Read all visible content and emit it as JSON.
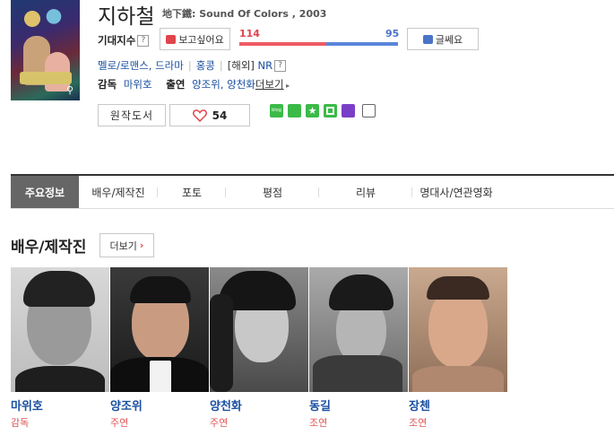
{
  "movie": {
    "title": "지하철",
    "subtitle": "地下鐵: Sound Of Colors , 2003"
  },
  "expectation": {
    "label": "기대지수",
    "help": "?",
    "want_label": "보고싶어요",
    "want_count": "114",
    "dislike_count": "95",
    "dislike_label": "글쎄요"
  },
  "meta": {
    "genre": "멜로/로맨스, 드라마",
    "country": "홍콩",
    "rating_prefix": "[해외]",
    "rating": "NR",
    "rating_help": "?"
  },
  "credits": {
    "director_label": "감독",
    "director": "마위호",
    "cast_label": "출연",
    "cast": "양조위, 양천화",
    "more": "더보기"
  },
  "actions": {
    "original_book": "원작도서",
    "likes": "54"
  },
  "tabs": [
    "주요정보",
    "배우/제작진",
    "포토",
    "평점",
    "리뷰",
    "명대사/연관영화"
  ],
  "cast_section": {
    "title": "배우/제작진",
    "more": "더보기"
  },
  "people": [
    {
      "name": "마위호",
      "role": "감독"
    },
    {
      "name": "양조위",
      "role": "주연"
    },
    {
      "name": "양천화",
      "role": "주연"
    },
    {
      "name": "동길",
      "role": "조연"
    },
    {
      "name": "장첸",
      "role": "조연"
    }
  ],
  "colors": {
    "want_bar": "#ee5b63",
    "dislike_bar": "#5b86da",
    "link": "#1a4fa0",
    "active_tab": "#666666"
  }
}
